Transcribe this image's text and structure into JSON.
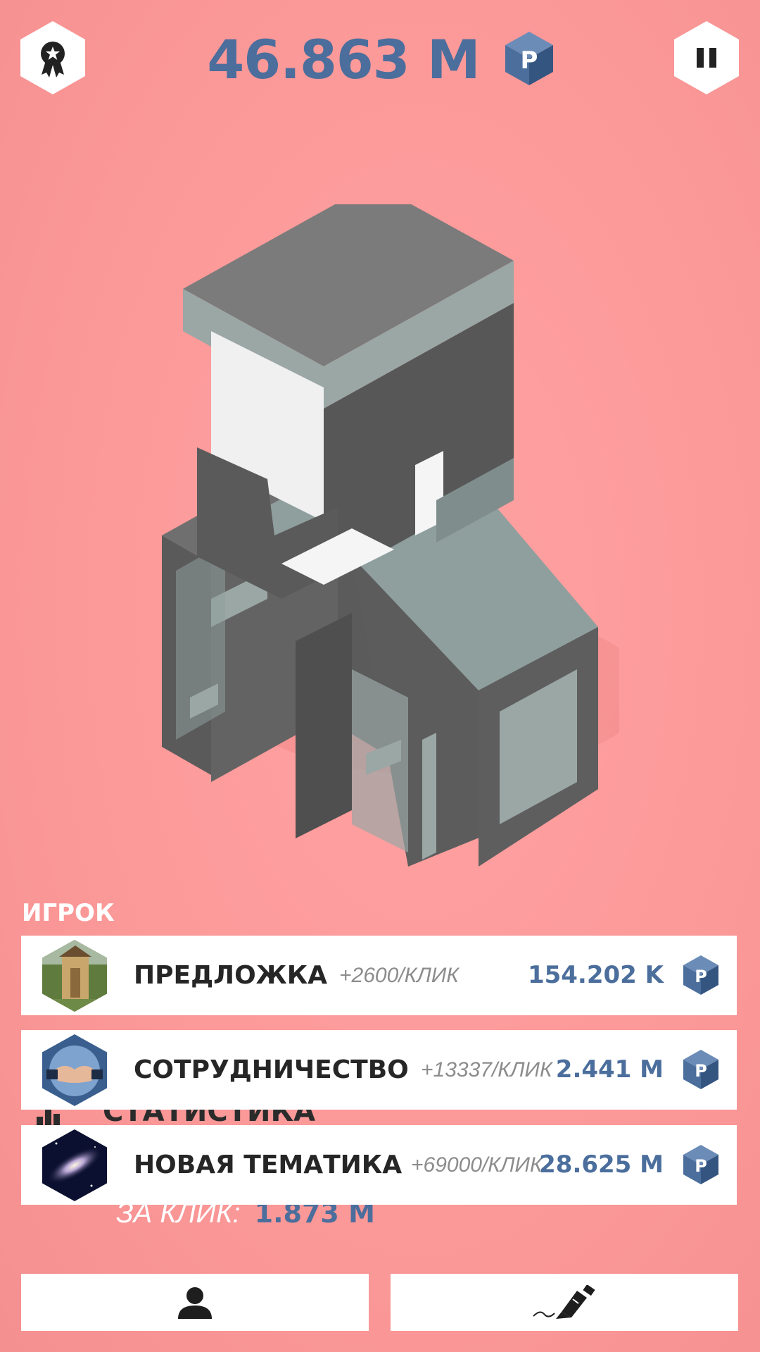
{
  "header": {
    "balance": "46.863 M",
    "currency_symbol": "P",
    "left_button_icon": "award-ribbon-icon",
    "right_button_icon": "pause-icon"
  },
  "section": {
    "title": "ИГРОК"
  },
  "upgrades": [
    {
      "name": "ПРЕДЛОЖКА",
      "rate": "+2600/КЛИК",
      "price": "154.202 K",
      "thumb": "outhouse-photo"
    },
    {
      "name": "СОТРУДНИЧЕСТВО",
      "rate": "+13337/КЛИК",
      "price": "2.441 M",
      "thumb": "handshake-photo"
    },
    {
      "name": "НОВАЯ ТЕМАТИКА",
      "rate": "+69000/КЛИК",
      "price": "28.625 M",
      "thumb": "galaxy-photo"
    }
  ],
  "stats": {
    "title": "СТАТИСТИКА",
    "per_click_label": "ЗА КЛИК:",
    "per_click_value": "1.873 M"
  },
  "bottom_bar": {
    "left_icon": "user-icon",
    "right_icon": "fountain-pen-icon"
  },
  "colors": {
    "background": "#fd9b9b",
    "accent": "#4b6e9c",
    "card": "#ffffff",
    "text_dark": "#262626",
    "text_muted": "#8c8c8c"
  }
}
